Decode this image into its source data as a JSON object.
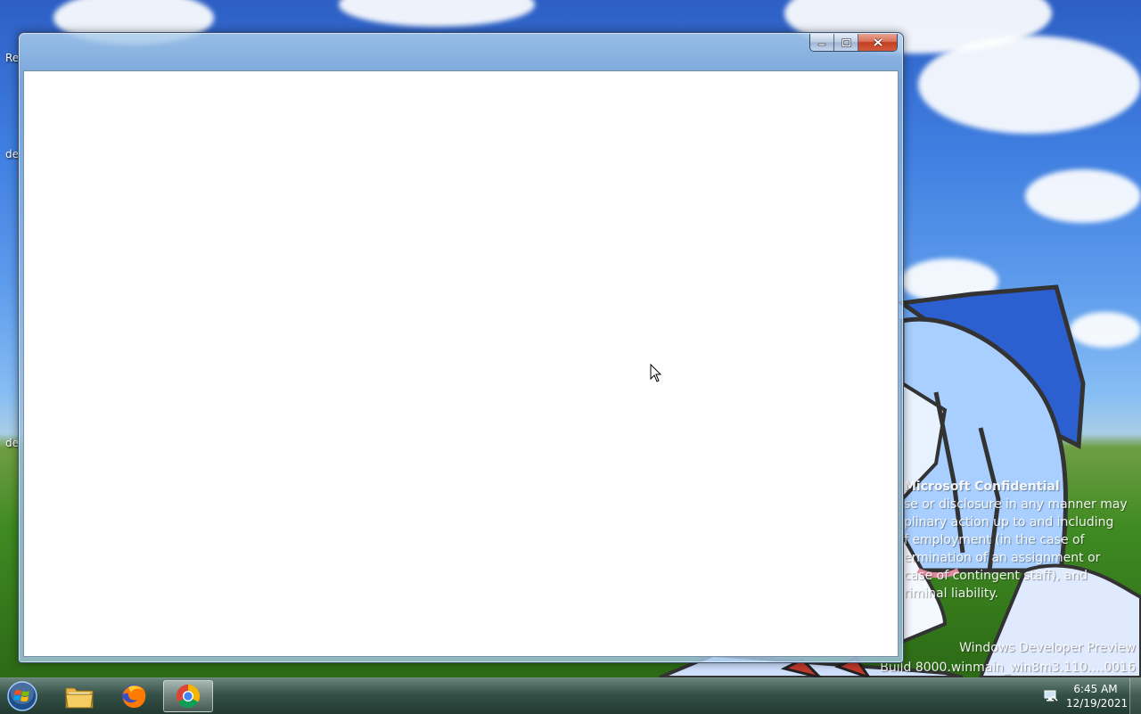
{
  "desktop": {
    "icon_labels": [
      "Re",
      "de",
      "de"
    ]
  },
  "watermark": {
    "title": "Microsoft Confidential",
    "body": "se or disclosure in any manner may\nplinary action up to and including\nf employment (in the case of\nermination of an assignment or\ncase of contingent staff), and\nriminal liability.",
    "build_line1": "Windows Developer Preview",
    "build_line2": "Build 8000.winmain_win8m3.110….0016"
  },
  "window": {
    "title": "",
    "minimize_label": "Minimize",
    "maximize_label": "Maximize",
    "close_label": "Close"
  },
  "taskbar": {
    "start_label": "Start",
    "pinned": [
      {
        "name": "Windows Explorer",
        "icon": "folder-icon"
      },
      {
        "name": "Mozilla Firefox",
        "icon": "firefox-icon"
      },
      {
        "name": "Google Chrome",
        "icon": "chrome-icon",
        "active": true
      }
    ],
    "clock_time": "6:45 AM",
    "clock_date": "12/19/2021"
  },
  "colors": {
    "taskbar": "#2a4a3c",
    "window_frame": "#a6c8e8",
    "close_button": "#c2401f"
  }
}
